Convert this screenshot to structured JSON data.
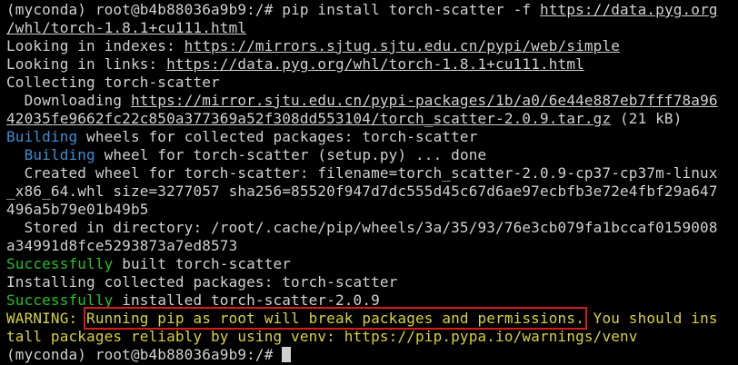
{
  "terminal": {
    "line1": {
      "prompt": "(myconda) root@b4b88036a9b9:/# ",
      "command": "pip install torch-scatter -f ",
      "url": "https://data.pyg.org"
    },
    "line2": {
      "url": "/whl/torch-1.8.1+cu111.html"
    },
    "line3": {
      "text": "Looking in indexes: ",
      "url": "https://mirrors.sjtug.sjtu.edu.cn/pypi/web/simple"
    },
    "line4": {
      "text": "Looking in links: ",
      "url": "https://data.pyg.org/whl/torch-1.8.1+cu111.html"
    },
    "line5": {
      "text": "Collecting torch-scatter"
    },
    "line6": {
      "text": "  Downloading ",
      "url": "https://mirror.sjtu.edu.cn/pypi-packages/1b/a0/6e44e887eb7fff78a96"
    },
    "line7": {
      "url": "42035fe9662fc22c850a377369a52f308dd553104/torch_scatter-2.0.9.tar.gz",
      "size": " (21 kB)"
    },
    "line8": {
      "keyword": "Building",
      "text": " wheels for collected packages: torch-scatter"
    },
    "line9": {
      "indent": "  ",
      "keyword": "Building",
      "text": " wheel for torch-scatter (setup.py) ... done"
    },
    "line10": {
      "text": "  Created wheel for torch-scatter: filename=torch_scatter-2.0.9-cp37-cp37m-linux"
    },
    "line11": {
      "text": "_x86_64.whl size=3277057 sha256=85520f947d7dc555d45c67d6ae97ecbfb3e72e4fbf29a647"
    },
    "line12": {
      "text": "496a5b79e01b49b5"
    },
    "line13": {
      "text": "  Stored in directory: /root/.cache/pip/wheels/3a/35/93/76e3cb079fa1bccaf0159008"
    },
    "line14": {
      "text": "a34991d8fce5293873a7ed8573"
    },
    "line15": {
      "keyword": "Successfully",
      "text": " built torch-scatter"
    },
    "line16": {
      "text": "Installing collected packages: torch-scatter"
    },
    "line17": {
      "keyword": "Successfully",
      "text": " installed torch-scatter-2.0.9"
    },
    "line18": {
      "warn": "WARNING: ",
      "highlighted": "Running pip as root will break packages and permissions.",
      "rest": " You should ins"
    },
    "line19": {
      "text": "tall packages reliably by using venv: https://pip.pypa.io/warnings/venv"
    },
    "line20": {
      "prompt": "(myconda) root@b4b88036a9b9:/# "
    }
  },
  "colors": {
    "background": "#000000",
    "text": "#d0d0d0",
    "keyword_blue": "#3c8fd6",
    "success_green": "#21c321",
    "warning_yellow": "#d6d23a",
    "highlight_box": "#d41e1e"
  }
}
